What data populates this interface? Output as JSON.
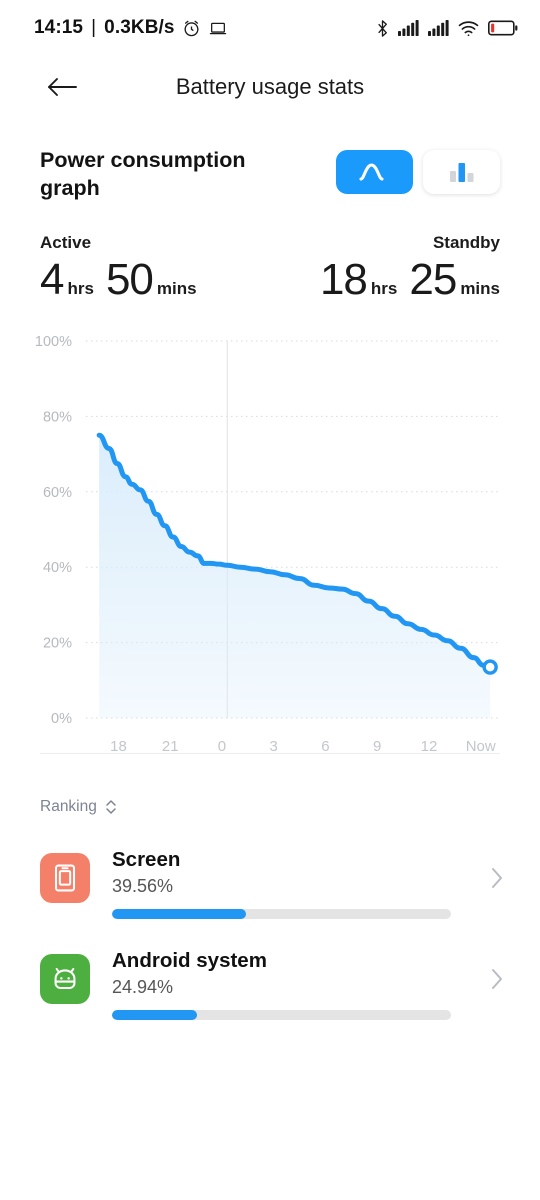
{
  "status_bar": {
    "time": "14:15",
    "separator": "|",
    "net_speed": "0.3KB/s",
    "icons_left": [
      "alarm-icon",
      "laptop-icon"
    ],
    "icons_right": [
      "bluetooth-icon",
      "signal-sim1-icon",
      "signal-sim2-icon",
      "wifi-icon",
      "battery-low-icon"
    ],
    "battery_low_color": "#e8322a"
  },
  "appbar": {
    "back_icon": "back-arrow-icon",
    "title": "Battery usage stats"
  },
  "section": {
    "title": "Power consumption graph",
    "toggles": [
      {
        "name": "line-graph-toggle",
        "icon": "curve-icon",
        "selected": true
      },
      {
        "name": "bar-graph-toggle",
        "icon": "bar-chart-icon",
        "selected": false
      }
    ],
    "accent_color": "#1a9afa"
  },
  "stats": {
    "active": {
      "label": "Active",
      "hours": "4",
      "hours_unit": "hrs",
      "minutes": "50",
      "minutes_unit": "mins"
    },
    "standby": {
      "label": "Standby",
      "hours": "18",
      "hours_unit": "hrs",
      "minutes": "25",
      "minutes_unit": "mins"
    }
  },
  "chart_data": {
    "type": "area",
    "title": "Power consumption graph",
    "xlabel": "",
    "ylabel": "",
    "ylim": [
      0,
      100
    ],
    "y_ticks": [
      0,
      20,
      40,
      60,
      80,
      100
    ],
    "y_tick_labels": [
      "0%",
      "20%",
      "40%",
      "60%",
      "80%",
      "100%"
    ],
    "x_tick_labels": [
      "18",
      "21",
      "0",
      "3",
      "6",
      "9",
      "12",
      "Now"
    ],
    "x_tick_hours": [
      18,
      21,
      0,
      3,
      6,
      9,
      12,
      24
    ],
    "grid": true,
    "line_color": "#2196f3",
    "fill_color": "#d9ecfb",
    "end_marker": "hollow-circle",
    "series": [
      {
        "name": "Battery level",
        "x": [
          16.2,
          16.8,
          17.3,
          17.8,
          18.2,
          18.7,
          19.2,
          19.7,
          20.2,
          20.7,
          21.2,
          21.7,
          22.2,
          22.6,
          23.0,
          23.5,
          24.0,
          24.8,
          25.7,
          26.6,
          27.5,
          28.4,
          29.3,
          30.2,
          31.0,
          31.8,
          32.6,
          33.4,
          34.2,
          35.0,
          35.8,
          36.6,
          37.4,
          38.2,
          39.0,
          39.6,
          40.0
        ],
        "values": [
          75.0,
          71.5,
          67.5,
          64.0,
          62.0,
          60.5,
          57.5,
          54.0,
          51.0,
          48.0,
          45.5,
          44.0,
          43.0,
          41.0,
          41.0,
          40.8,
          40.5,
          40.0,
          39.5,
          38.8,
          38.0,
          37.0,
          35.2,
          34.5,
          34.2,
          33.0,
          31.0,
          29.0,
          27.0,
          25.0,
          23.5,
          22.0,
          20.5,
          18.5,
          16.0,
          14.0,
          13.5
        ]
      }
    ]
  },
  "ranking": {
    "label": "Ranking",
    "sort_icon": "sort-updown-icon",
    "items": [
      {
        "name": "Screen",
        "percent_label": "39.56%",
        "percent_value": 39.56,
        "progress_ratio": 0.3956,
        "icon_name": "screen-icon",
        "icon_color": "#f4806a",
        "chevron": "chevron-right-icon"
      },
      {
        "name": "Android system",
        "percent_label": "24.94%",
        "percent_value": 24.94,
        "progress_ratio": 0.2494,
        "icon_name": "android-robot-icon",
        "icon_color": "#4caf3f",
        "chevron": "chevron-right-icon"
      }
    ]
  }
}
